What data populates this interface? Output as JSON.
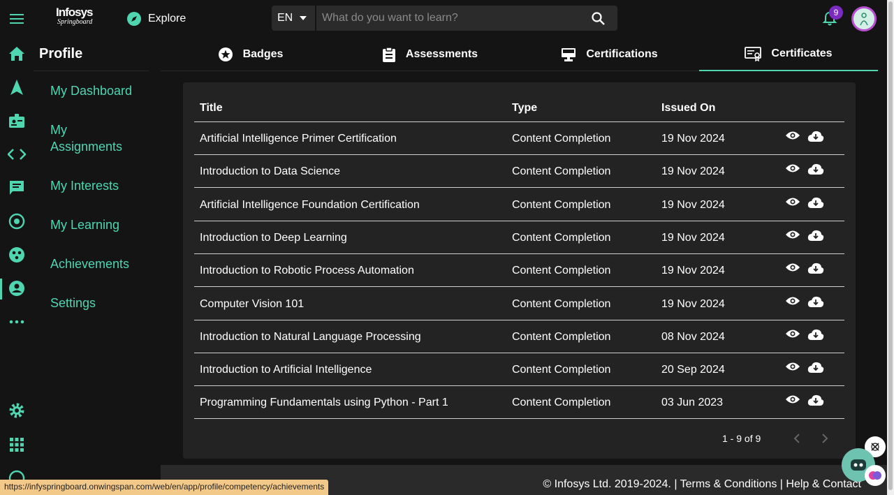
{
  "header": {
    "logo_line1": "Infosys",
    "logo_line2": "Springboard",
    "explore_label": "Explore",
    "language": "EN",
    "search_placeholder": "What do you want to learn?",
    "notification_count": "9"
  },
  "rail": {
    "icons": [
      "home-icon",
      "navigation-icon",
      "id-badge-icon",
      "code-icon",
      "chat-icon",
      "target-icon",
      "groups-icon",
      "profile-icon",
      "more-icon",
      "settings-icon",
      "apps-grid-icon",
      "help-icon"
    ],
    "active": "profile-icon"
  },
  "sidebar": {
    "title": "Profile",
    "items": [
      {
        "label": "My Dashboard"
      },
      {
        "label": "My Assignments"
      },
      {
        "label": "My Interests"
      },
      {
        "label": "My Learning"
      },
      {
        "label": "Achievements"
      },
      {
        "label": "Settings"
      }
    ]
  },
  "tabs": [
    {
      "label": "Badges",
      "icon": "star-badge-icon"
    },
    {
      "label": "Assessments",
      "icon": "clipboard-icon"
    },
    {
      "label": "Certifications",
      "icon": "presentation-icon"
    },
    {
      "label": "Certificates",
      "icon": "certificate-icon",
      "active": true
    }
  ],
  "table": {
    "headers": {
      "title": "Title",
      "type": "Type",
      "issued": "Issued On"
    },
    "rows": [
      {
        "title": "Artificial Intelligence Primer Certification",
        "type": "Content Completion",
        "issued": "19 Nov 2024"
      },
      {
        "title": "Introduction to Data Science",
        "type": "Content Completion",
        "issued": "19 Nov 2024"
      },
      {
        "title": "Artificial Intelligence Foundation Certification",
        "type": "Content Completion",
        "issued": "19 Nov 2024"
      },
      {
        "title": "Introduction to Deep Learning",
        "type": "Content Completion",
        "issued": "19 Nov 2024"
      },
      {
        "title": "Introduction to Robotic Process Automation",
        "type": "Content Completion",
        "issued": "19 Nov 2024"
      },
      {
        "title": "Computer Vision 101",
        "type": "Content Completion",
        "issued": "19 Nov 2024"
      },
      {
        "title": "Introduction to Natural Language Processing",
        "type": "Content Completion",
        "issued": "08 Nov 2024"
      },
      {
        "title": "Introduction to Artificial Intelligence",
        "type": "Content Completion",
        "issued": "20 Sep 2024"
      },
      {
        "title": "Programming Fundamentals using Python - Part 1",
        "type": "Content Completion",
        "issued": "03 Jun 2023"
      }
    ],
    "pagination": "1 - 9 of 9"
  },
  "footer": {
    "text": "© Infosys Ltd. 2019-2024. | Terms & Conditions | Help & Contact"
  },
  "status_url": "https://infyspringboard.onwingspan.com/web/en/app/profile/competency/achievements",
  "colors": {
    "accent": "#4fd6b0",
    "background": "#141414",
    "card": "#232323",
    "badge": "#7b2bbf"
  }
}
